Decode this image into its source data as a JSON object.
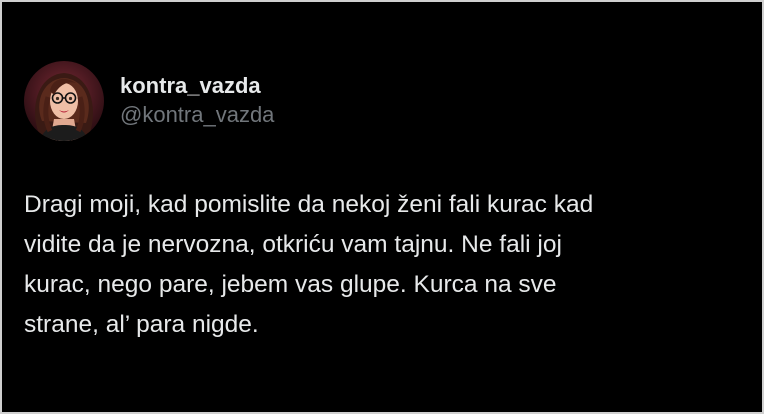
{
  "profile": {
    "display_name": "kontra_vazda",
    "handle": "@kontra_vazda",
    "avatar_icon": "avatar-woman-glasses"
  },
  "tweet": {
    "text": "Dragi moji, kad pomislite da nekoj ženi fali kurac kad\nvidite da je nervozna, otkriću vam tajnu. Ne fali joj\nkurac, nego pare, jebem vas glupe. Kurca na sve\nstrane, al’ para nigde."
  },
  "colors": {
    "background": "#000000",
    "text": "#e7e9ea",
    "muted": "#71767b"
  }
}
